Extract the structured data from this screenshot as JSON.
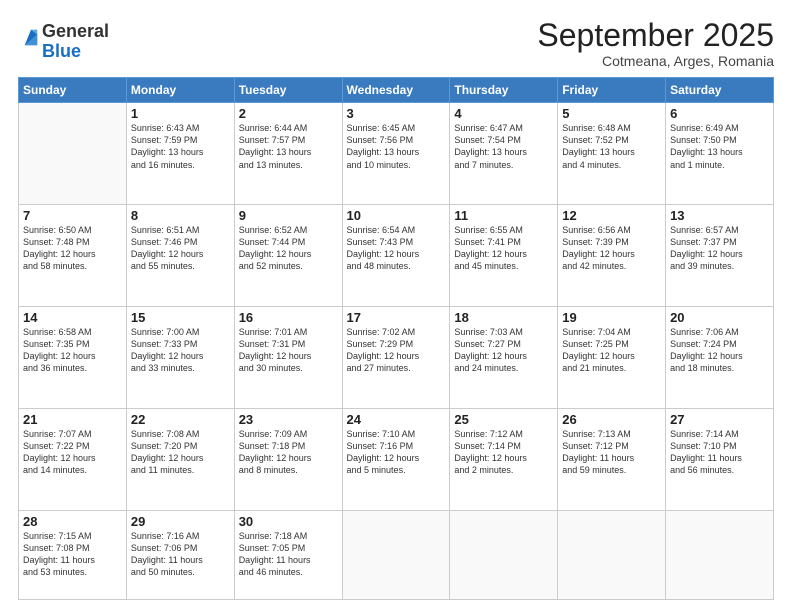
{
  "logo": {
    "general": "General",
    "blue": "Blue"
  },
  "header": {
    "month": "September 2025",
    "location": "Cotmeana, Arges, Romania"
  },
  "weekdays": [
    "Sunday",
    "Monday",
    "Tuesday",
    "Wednesday",
    "Thursday",
    "Friday",
    "Saturday"
  ],
  "weeks": [
    [
      {
        "day": "",
        "info": ""
      },
      {
        "day": "1",
        "info": "Sunrise: 6:43 AM\nSunset: 7:59 PM\nDaylight: 13 hours\nand 16 minutes."
      },
      {
        "day": "2",
        "info": "Sunrise: 6:44 AM\nSunset: 7:57 PM\nDaylight: 13 hours\nand 13 minutes."
      },
      {
        "day": "3",
        "info": "Sunrise: 6:45 AM\nSunset: 7:56 PM\nDaylight: 13 hours\nand 10 minutes."
      },
      {
        "day": "4",
        "info": "Sunrise: 6:47 AM\nSunset: 7:54 PM\nDaylight: 13 hours\nand 7 minutes."
      },
      {
        "day": "5",
        "info": "Sunrise: 6:48 AM\nSunset: 7:52 PM\nDaylight: 13 hours\nand 4 minutes."
      },
      {
        "day": "6",
        "info": "Sunrise: 6:49 AM\nSunset: 7:50 PM\nDaylight: 13 hours\nand 1 minute."
      }
    ],
    [
      {
        "day": "7",
        "info": "Sunrise: 6:50 AM\nSunset: 7:48 PM\nDaylight: 12 hours\nand 58 minutes."
      },
      {
        "day": "8",
        "info": "Sunrise: 6:51 AM\nSunset: 7:46 PM\nDaylight: 12 hours\nand 55 minutes."
      },
      {
        "day": "9",
        "info": "Sunrise: 6:52 AM\nSunset: 7:44 PM\nDaylight: 12 hours\nand 52 minutes."
      },
      {
        "day": "10",
        "info": "Sunrise: 6:54 AM\nSunset: 7:43 PM\nDaylight: 12 hours\nand 48 minutes."
      },
      {
        "day": "11",
        "info": "Sunrise: 6:55 AM\nSunset: 7:41 PM\nDaylight: 12 hours\nand 45 minutes."
      },
      {
        "day": "12",
        "info": "Sunrise: 6:56 AM\nSunset: 7:39 PM\nDaylight: 12 hours\nand 42 minutes."
      },
      {
        "day": "13",
        "info": "Sunrise: 6:57 AM\nSunset: 7:37 PM\nDaylight: 12 hours\nand 39 minutes."
      }
    ],
    [
      {
        "day": "14",
        "info": "Sunrise: 6:58 AM\nSunset: 7:35 PM\nDaylight: 12 hours\nand 36 minutes."
      },
      {
        "day": "15",
        "info": "Sunrise: 7:00 AM\nSunset: 7:33 PM\nDaylight: 12 hours\nand 33 minutes."
      },
      {
        "day": "16",
        "info": "Sunrise: 7:01 AM\nSunset: 7:31 PM\nDaylight: 12 hours\nand 30 minutes."
      },
      {
        "day": "17",
        "info": "Sunrise: 7:02 AM\nSunset: 7:29 PM\nDaylight: 12 hours\nand 27 minutes."
      },
      {
        "day": "18",
        "info": "Sunrise: 7:03 AM\nSunset: 7:27 PM\nDaylight: 12 hours\nand 24 minutes."
      },
      {
        "day": "19",
        "info": "Sunrise: 7:04 AM\nSunset: 7:25 PM\nDaylight: 12 hours\nand 21 minutes."
      },
      {
        "day": "20",
        "info": "Sunrise: 7:06 AM\nSunset: 7:24 PM\nDaylight: 12 hours\nand 18 minutes."
      }
    ],
    [
      {
        "day": "21",
        "info": "Sunrise: 7:07 AM\nSunset: 7:22 PM\nDaylight: 12 hours\nand 14 minutes."
      },
      {
        "day": "22",
        "info": "Sunrise: 7:08 AM\nSunset: 7:20 PM\nDaylight: 12 hours\nand 11 minutes."
      },
      {
        "day": "23",
        "info": "Sunrise: 7:09 AM\nSunset: 7:18 PM\nDaylight: 12 hours\nand 8 minutes."
      },
      {
        "day": "24",
        "info": "Sunrise: 7:10 AM\nSunset: 7:16 PM\nDaylight: 12 hours\nand 5 minutes."
      },
      {
        "day": "25",
        "info": "Sunrise: 7:12 AM\nSunset: 7:14 PM\nDaylight: 12 hours\nand 2 minutes."
      },
      {
        "day": "26",
        "info": "Sunrise: 7:13 AM\nSunset: 7:12 PM\nDaylight: 11 hours\nand 59 minutes."
      },
      {
        "day": "27",
        "info": "Sunrise: 7:14 AM\nSunset: 7:10 PM\nDaylight: 11 hours\nand 56 minutes."
      }
    ],
    [
      {
        "day": "28",
        "info": "Sunrise: 7:15 AM\nSunset: 7:08 PM\nDaylight: 11 hours\nand 53 minutes."
      },
      {
        "day": "29",
        "info": "Sunrise: 7:16 AM\nSunset: 7:06 PM\nDaylight: 11 hours\nand 50 minutes."
      },
      {
        "day": "30",
        "info": "Sunrise: 7:18 AM\nSunset: 7:05 PM\nDaylight: 11 hours\nand 46 minutes."
      },
      {
        "day": "",
        "info": ""
      },
      {
        "day": "",
        "info": ""
      },
      {
        "day": "",
        "info": ""
      },
      {
        "day": "",
        "info": ""
      }
    ]
  ]
}
